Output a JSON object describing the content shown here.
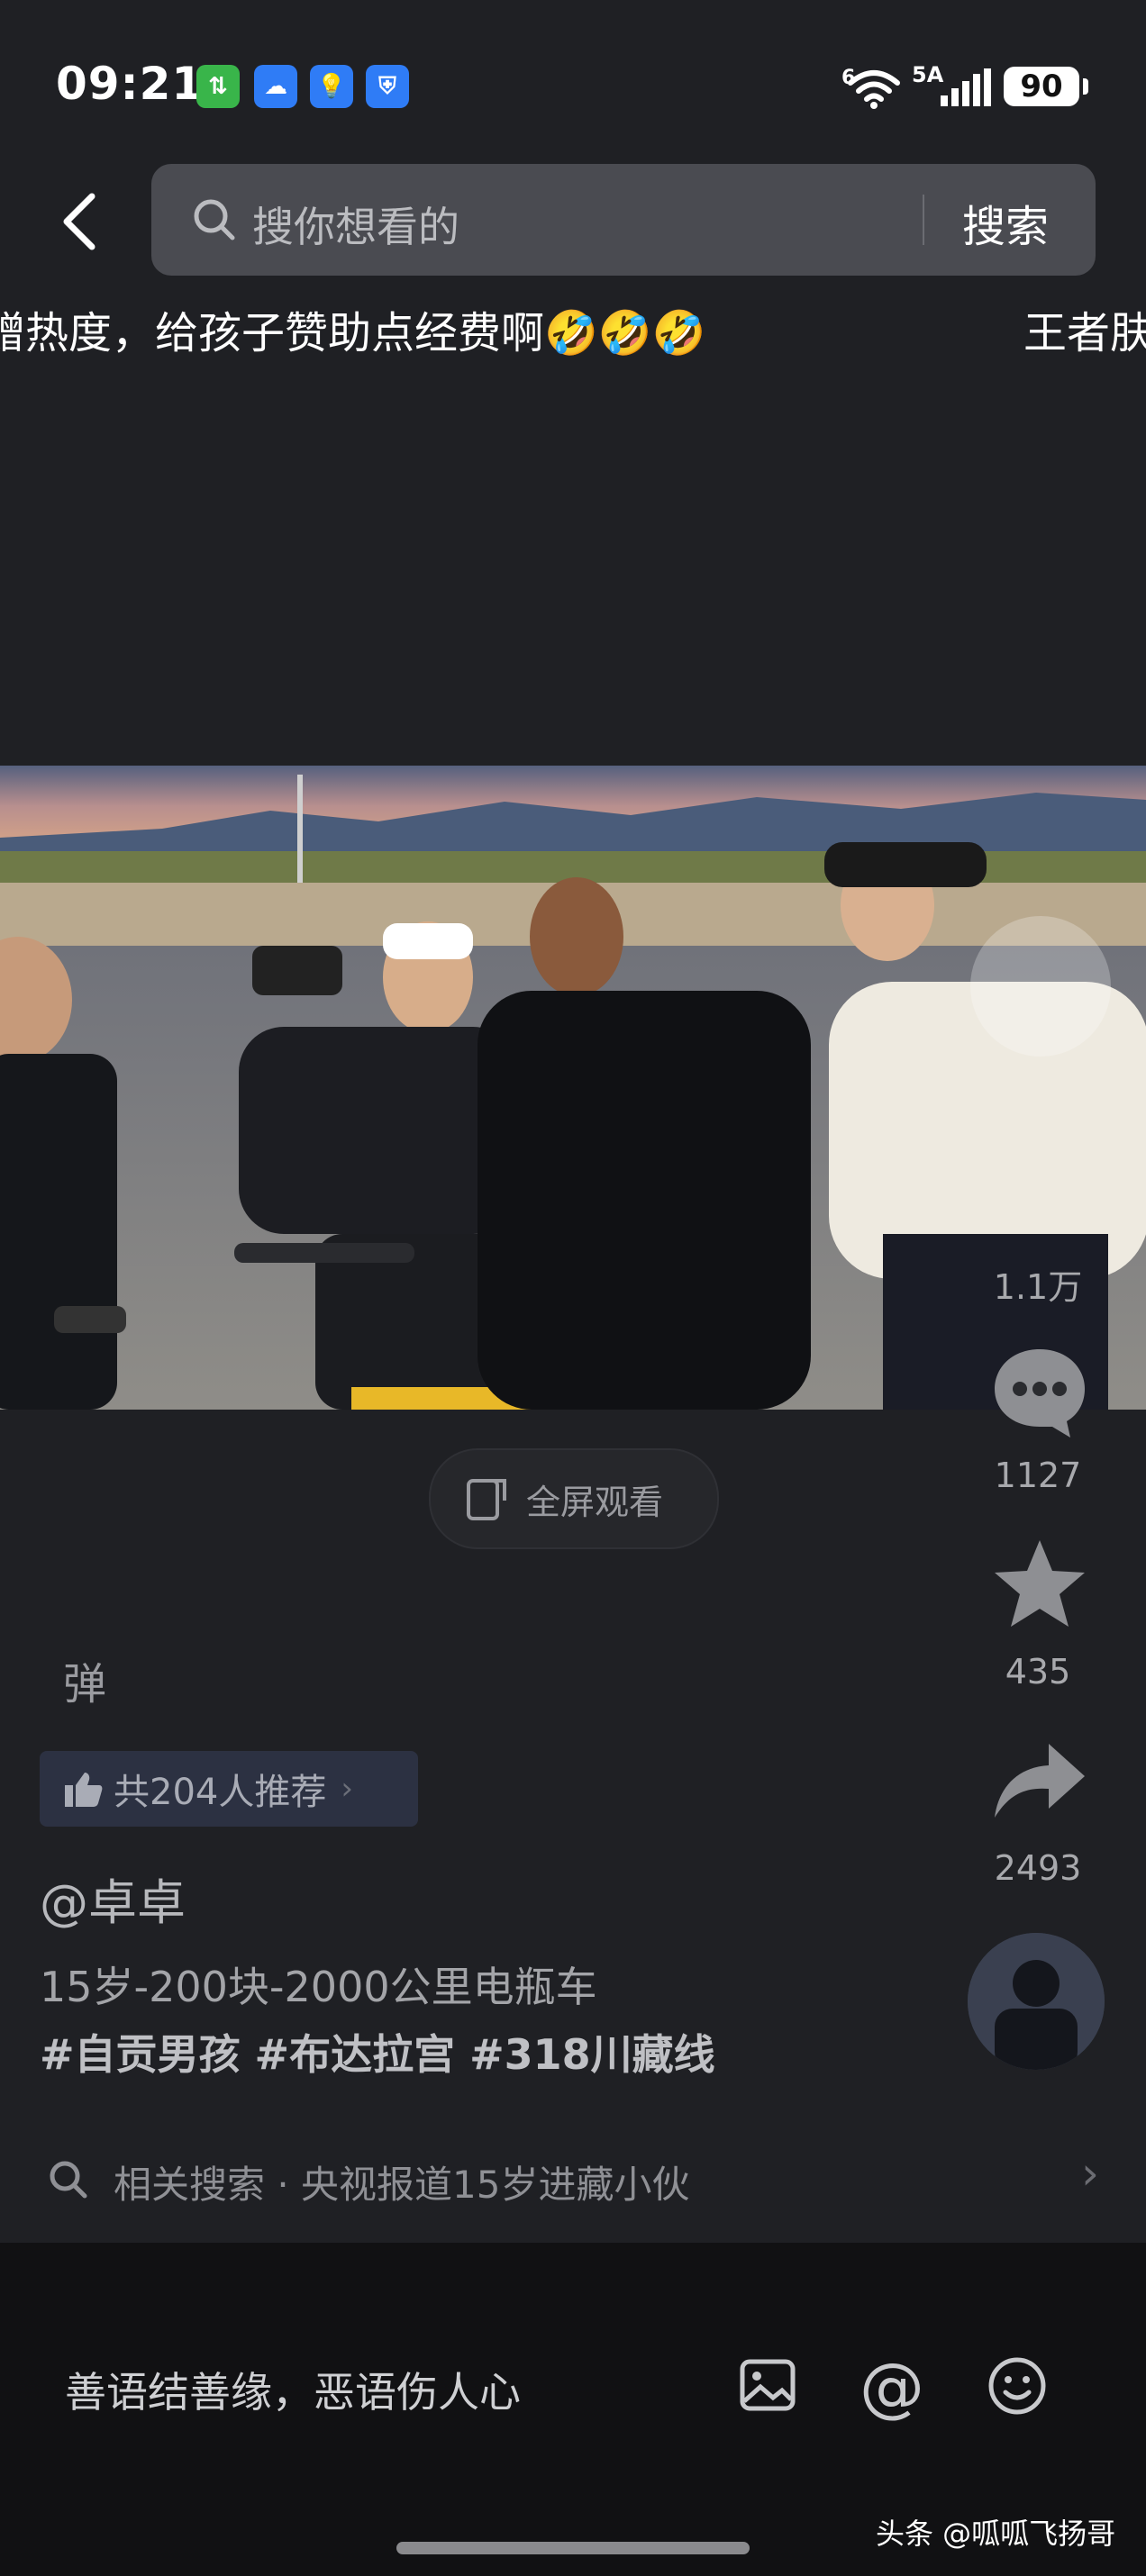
{
  "status_bar": {
    "time": "09:21",
    "app_badges": [
      {
        "icon": "data-usage-icon",
        "color": "#39b54a"
      },
      {
        "icon": "cloud-icon",
        "color": "#2f7cf6"
      },
      {
        "icon": "lightbulb-icon",
        "color": "#2f7cf6"
      },
      {
        "icon": "shield-icon",
        "color": "#2f7cf6"
      }
    ],
    "wifi_label": "6",
    "network_label": "5A",
    "battery": "90"
  },
  "header": {
    "search_placeholder": "搜你想看的",
    "search_button": "搜索"
  },
  "danmaku": [
    "赠热度，给孩子赞助点经费啊🤣🤣🤣",
    "王者肤"
  ],
  "player": {
    "full_screen_label": "全屏观看",
    "danmaku_toggle": "弹"
  },
  "actions": {
    "likes": "1.1万",
    "comments": "1127",
    "favorites": "435",
    "shares": "2493"
  },
  "info": {
    "recommend": "共204人推荐",
    "author": "@卓卓",
    "title": "15岁-200块-2000公里电瓶车",
    "hashtags": "#自贡男孩 #布达拉宫 #318川藏线",
    "related_search": "相关搜索 · 央视报道15岁进藏小伙"
  },
  "comment_bar": {
    "placeholder": "善语结善缘，恶语伤人心"
  },
  "watermark": "头条 @呱呱飞扬哥",
  "colors": {
    "background": "#1f2024",
    "search_box": "#4a4b51",
    "comment_bar": "#111113",
    "recommend_pill": "#2c3142"
  }
}
